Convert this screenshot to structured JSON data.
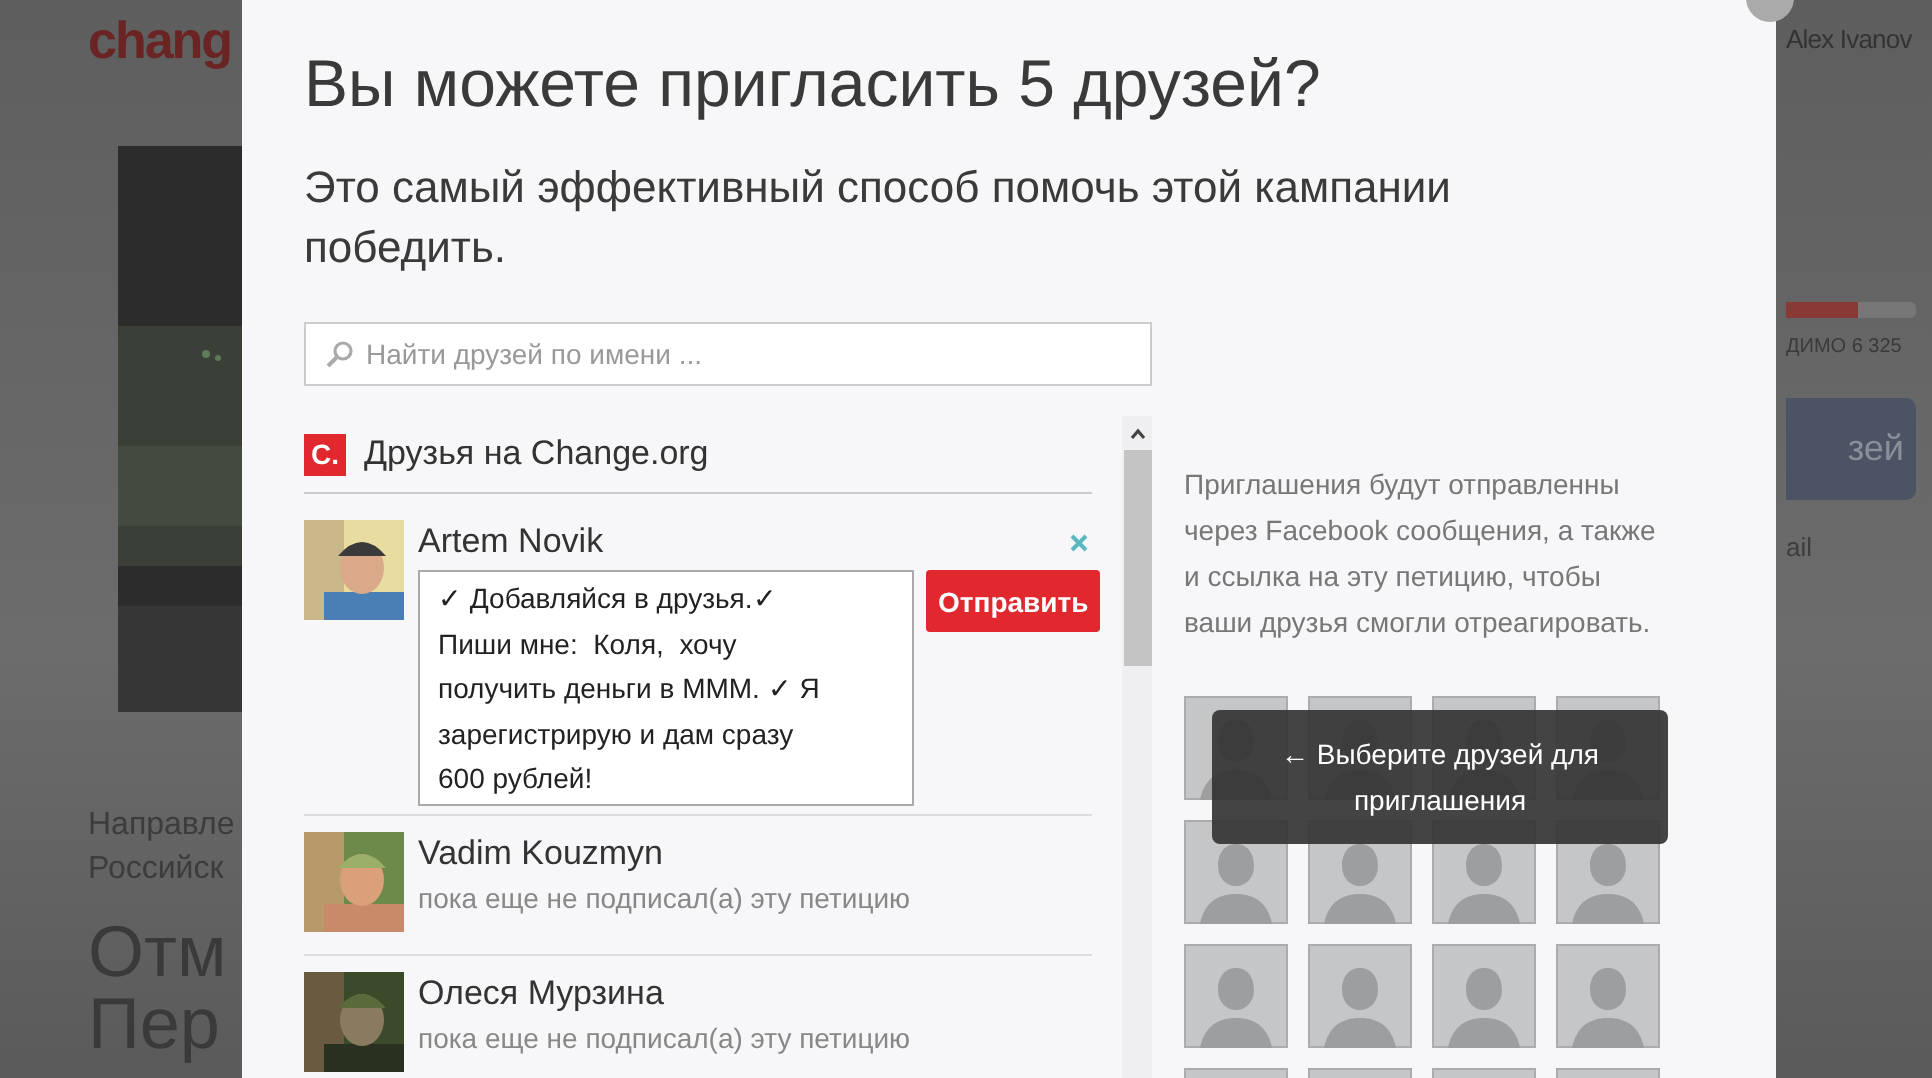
{
  "background": {
    "logo": "chang",
    "user": "Alex Ivanov",
    "category_lines": [
      "Направле",
      "Российск"
    ],
    "headline_lines": [
      "Отм",
      "Пер"
    ],
    "progress": {
      "level": 0.55
    },
    "progress_caption": "ДИМО 6 325",
    "share_button": "зей",
    "email_link": "ail"
  },
  "modal": {
    "title": "Вы можете пригласить 5 друзей?",
    "subtitle": "Это самый эффективный способ помочь этой кампании победить.",
    "search": {
      "placeholder": "Найти друзей по имени ..."
    },
    "friends_section": {
      "logo": "C.",
      "title": "Друзья на Change.org"
    },
    "friends": [
      {
        "kind": "composer",
        "name": "Artem Novik",
        "message": "✓ Добавляйся в друзья.✓ Пиши мне:  Коля,  хочу получить деньги в МММ. ✓ Я зарегистрирую и дам сразу 600 рублей!",
        "button": "Отправить"
      },
      {
        "kind": "row",
        "name": "Vadim Kouzmyn",
        "status": "пока еще не подписал(а) эту петицию"
      },
      {
        "kind": "row",
        "name": "Олеся Мурзина",
        "status": "пока еще не подписал(а) эту петицию"
      }
    ],
    "info": "Приглашения будут отправленны через Facebook сообщения, а также и ссылка на эту петицию, чтобы ваши друзья смогли отреагировать.",
    "tooltip": "← Выберите друзей для приглашения"
  }
}
